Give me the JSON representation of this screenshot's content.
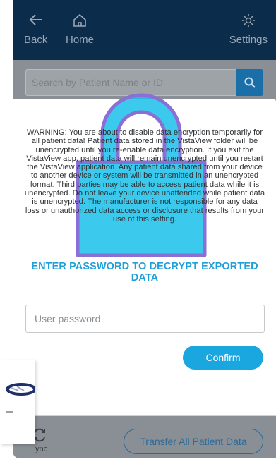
{
  "header": {
    "back_label": "Back",
    "home_label": "Home",
    "settings_label": "Settings"
  },
  "search": {
    "placeholder": "Search by Patient Name or ID"
  },
  "dialog": {
    "warning_text": "WARNING: You are about to disable data encryption temporarily for all patient data! Patient data stored in the VistaView folder will be unencrypted until you re-enable data encryption. If you exit the VistaView app, patient data will remain unencrypted until you restart the VistaView application. Any patient data shared from your device to another device or system will be transmitted in an unencrypted format. Third parties may be able to access patient data while it is unencrypted. Do not leave your device unattended while patient data is unencrypted. The manufacturer is not responsible for any data loss or unauthorized data access or disclosure that results from your use of this setting.",
    "title": "ENTER PASSWORD TO DECRYPT EXPORTED DATA",
    "password_placeholder": "User password",
    "confirm_label": "Confirm"
  },
  "footer": {
    "sync_label": "ync",
    "transfer_label": "Transfer All Patient Data"
  },
  "icons": {
    "back": "arrow-left-icon",
    "home": "home-icon",
    "settings": "gear-icon",
    "search": "search-icon",
    "lock": "padlock-icon",
    "sync": "sync-icon"
  },
  "colors": {
    "header_bg": "#0b2c4a",
    "accent": "#1aa7e0",
    "search_button": "#1b6fa8",
    "lock_fill": "#19c1ea",
    "lock_outline": "#8a6fd6"
  }
}
